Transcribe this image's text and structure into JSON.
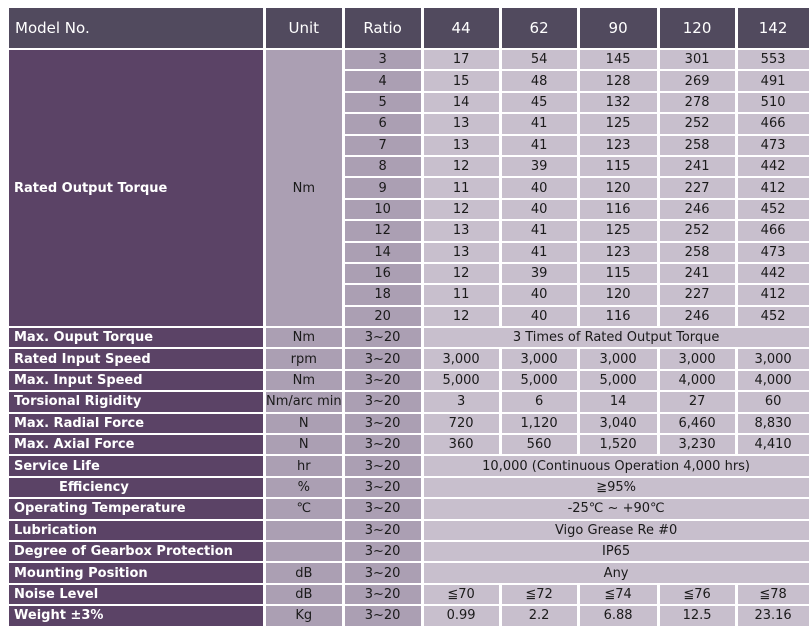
{
  "header": {
    "model_no": "Model No.",
    "unit": "Unit",
    "ratio": "Ratio",
    "models": [
      "44",
      "62",
      "90",
      "120",
      "142"
    ]
  },
  "rated_output_torque": {
    "label": "Rated Output Torque",
    "unit": "Nm",
    "rows": [
      {
        "ratio": "3",
        "values": [
          "17",
          "54",
          "145",
          "301",
          "553"
        ]
      },
      {
        "ratio": "4",
        "values": [
          "15",
          "48",
          "128",
          "269",
          "491"
        ]
      },
      {
        "ratio": "5",
        "values": [
          "14",
          "45",
          "132",
          "278",
          "510"
        ]
      },
      {
        "ratio": "6",
        "values": [
          "13",
          "41",
          "125",
          "252",
          "466"
        ]
      },
      {
        "ratio": "7",
        "values": [
          "13",
          "41",
          "123",
          "258",
          "473"
        ]
      },
      {
        "ratio": "8",
        "values": [
          "12",
          "39",
          "115",
          "241",
          "442"
        ]
      },
      {
        "ratio": "9",
        "values": [
          "11",
          "40",
          "120",
          "227",
          "412"
        ]
      },
      {
        "ratio": "10",
        "values": [
          "12",
          "40",
          "116",
          "246",
          "452"
        ]
      },
      {
        "ratio": "12",
        "values": [
          "13",
          "41",
          "125",
          "252",
          "466"
        ]
      },
      {
        "ratio": "14",
        "values": [
          "13",
          "41",
          "123",
          "258",
          "473"
        ]
      },
      {
        "ratio": "16",
        "values": [
          "12",
          "39",
          "115",
          "241",
          "442"
        ]
      },
      {
        "ratio": "18",
        "values": [
          "11",
          "40",
          "120",
          "227",
          "412"
        ]
      },
      {
        "ratio": "20",
        "values": [
          "12",
          "40",
          "116",
          "246",
          "452"
        ]
      }
    ]
  },
  "specs": [
    {
      "label": "Max. Ouput Torque",
      "unit": "Nm",
      "ratio": "3~20",
      "merged": "3 Times of Rated Output Torque"
    },
    {
      "label": "Rated Input Speed",
      "unit": "rpm",
      "ratio": "3~20",
      "values": [
        "3,000",
        "3,000",
        "3,000",
        "3,000",
        "3,000"
      ]
    },
    {
      "label": "Max. Input Speed",
      "unit": "Nm",
      "ratio": "3~20",
      "values": [
        "5,000",
        "5,000",
        "5,000",
        "4,000",
        "4,000"
      ]
    },
    {
      "label": "Torsional Rigidity",
      "unit": "Nm/arc min",
      "ratio": "3~20",
      "values": [
        "3",
        "6",
        "14",
        "27",
        "60"
      ]
    },
    {
      "label": "Max. Radial Force",
      "unit": "N",
      "ratio": "3~20",
      "values": [
        "720",
        "1,120",
        "3,040",
        "6,460",
        "8,830"
      ]
    },
    {
      "label": "Max. Axial Force",
      "unit": "N",
      "ratio": "3~20",
      "values": [
        "360",
        "560",
        "1,520",
        "3,230",
        "4,410"
      ]
    },
    {
      "label": "Service Life",
      "unit": "hr",
      "ratio": "3~20",
      "merged": "10,000 (Continuous Operation 4,000 hrs)"
    },
    {
      "label": "Efficiency",
      "unit": "%",
      "ratio": "3~20",
      "merged": "≧95%",
      "indent": true
    },
    {
      "label": "Operating Temperature",
      "unit": "℃",
      "ratio": "3~20",
      "merged": "-25℃ ~ +90℃"
    },
    {
      "label": "Lubrication",
      "unit": "",
      "ratio": "3~20",
      "merged": "Vigo Grease Re #0"
    },
    {
      "label": "Degree of Gearbox Protection",
      "unit": "",
      "ratio": "3~20",
      "merged": "IP65"
    },
    {
      "label": "Mounting Position",
      "unit": "dB",
      "ratio": "3~20",
      "merged": "Any"
    },
    {
      "label": "Noise Level",
      "unit": "dB",
      "ratio": "3~20",
      "values": [
        "≦70",
        "≦72",
        "≦74",
        "≦76",
        "≦78"
      ]
    },
    {
      "label": "Weight ±3%",
      "unit": "Kg",
      "ratio": "3~20",
      "values": [
        "0.99",
        "2.2",
        "6.88",
        "12.5",
        "23.16"
      ]
    }
  ],
  "colors": {
    "header_bg": "#514a5e",
    "label_bg": "#5b4366",
    "unit_bg": "#ab9fb3",
    "value_bg": "#c8bfcd"
  }
}
